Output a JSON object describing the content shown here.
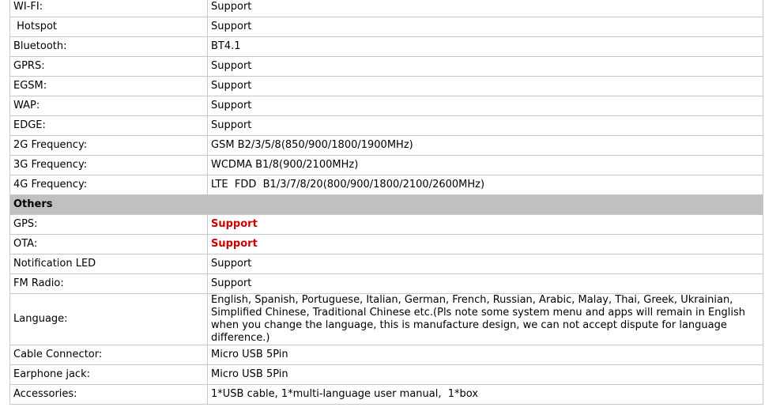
{
  "rows_top": [
    {
      "label": "WI-FI:",
      "value": "Support"
    },
    {
      "label": " Hotspot",
      "value": "Support"
    },
    {
      "label": "Bluetooth:",
      "value": "BT4.1"
    },
    {
      "label": "GPRS:",
      "value": "Support"
    },
    {
      "label": "EGSM:",
      "value": "Support"
    },
    {
      "label": "WAP:",
      "value": "Support"
    },
    {
      "label": "EDGE:",
      "value": "Support"
    },
    {
      "label": "2G Frequency:",
      "value": "GSM B2/3/5/8(850/900/1800/1900MHz)"
    },
    {
      "label": "3G Frequency:",
      "value": "WCDMA B1/8(900/2100MHz)"
    },
    {
      "label": "4G Frequency:",
      "value": "LTE  FDD  B1/3/7/8/20(800/900/1800/2100/2600MHz)"
    }
  ],
  "section": {
    "title": "Others"
  },
  "rows_others": [
    {
      "label": "GPS:",
      "value": "Support"
    },
    {
      "label": "OTA:",
      "value": "Support"
    },
    {
      "label": "Notification LED",
      "value": "Support"
    },
    {
      "label": "FM Radio:",
      "value": "Support"
    },
    {
      "label": "Language:",
      "value": "English, Spanish, Portuguese, Italian, German,  French, Russian, Arabic, Malay, Thai, Greek, Ukrainian, Simplified Chinese, Traditional Chinese etc.(Pls note some system menu and apps will remain in English when you change the language, this is manufacture design, we can not accept dispute for language difference.)"
    },
    {
      "label": "Cable Connector:",
      "value": "Micro USB 5Pin"
    },
    {
      "label": "Earphone jack:",
      "value": "Micro USB 5Pin"
    },
    {
      "label": "Accessories:",
      "value": "1*USB cable, 1*multi-language user manual,  1*box"
    }
  ],
  "colors": {
    "emphasis": "#cc0000",
    "section_bg": "#c0c0c0",
    "border": "#c8c8c8"
  }
}
